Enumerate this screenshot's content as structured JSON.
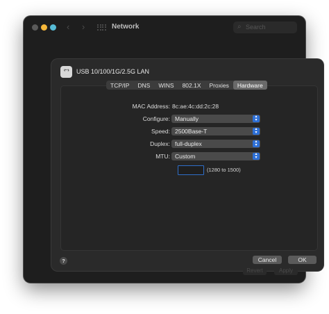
{
  "window": {
    "title": "Network",
    "search_placeholder": "Search",
    "nav_back": "‹",
    "nav_forward": "›",
    "revert_label": "Revert",
    "apply_label": "Apply"
  },
  "sheet": {
    "interface_icon_text": "‹··›",
    "interface_name": "USB 10/100/1G/2.5G LAN",
    "tabs": [
      {
        "label": "TCP/IP",
        "active": false
      },
      {
        "label": "DNS",
        "active": false
      },
      {
        "label": "WINS",
        "active": false
      },
      {
        "label": "802.1X",
        "active": false
      },
      {
        "label": "Proxies",
        "active": false
      },
      {
        "label": "Hardware",
        "active": true
      }
    ],
    "hardware": {
      "mac_label": "MAC Address:",
      "mac_value": "8c:ae:4c:dd:2c:28",
      "configure_label": "Configure:",
      "configure_value": "Manually",
      "speed_label": "Speed:",
      "speed_value": "2500Base-T",
      "duplex_label": "Duplex:",
      "duplex_value": "full-duplex",
      "mtu_label": "MTU:",
      "mtu_value": "Custom",
      "mtu_input_value": "",
      "mtu_range": "(1280 to 1500)"
    },
    "help_label": "?",
    "cancel_label": "Cancel",
    "ok_label": "OK"
  },
  "colors": {
    "accent": "#2d6fd6",
    "minimize": "#f5b73a",
    "zoom": "#57bcd6"
  }
}
